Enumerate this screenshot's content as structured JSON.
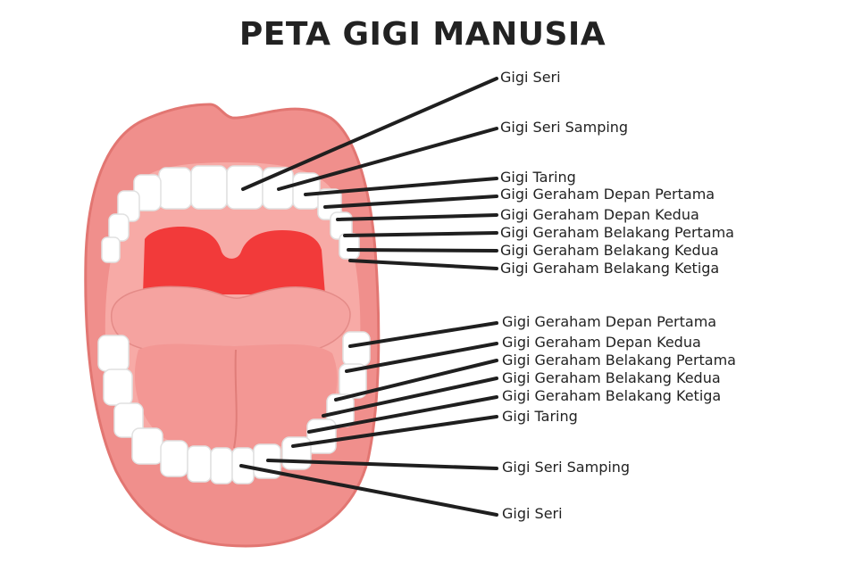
{
  "title": "PETA GIGI MANUSIA",
  "colors": {
    "lip": "#f08f8c",
    "lip_edge": "#e07672",
    "mouth_inner": "#f7a7a4",
    "throat": "#f23a3a",
    "tongue": "#f5a09c",
    "tooth": "#ffffff",
    "leader_line": "#1f1f1f"
  },
  "labels": {
    "upper": [
      "Gigi Seri",
      "Gigi Seri Samping",
      "Gigi Taring",
      "Gigi Geraham Depan Pertama",
      "Gigi Geraham Depan Kedua",
      "Gigi Geraham Belakang Pertama",
      "Gigi Geraham Belakang Kedua",
      "Gigi Geraham Belakang Ketiga"
    ],
    "lower": [
      "Gigi Geraham Depan Pertama",
      "Gigi Geraham Depan Kedua",
      "Gigi Geraham Belakang Pertama",
      "Gigi Geraham Belakang Kedua",
      "Gigi Geraham Belakang Ketiga",
      "Gigi Taring",
      "Gigi Seri Samping",
      "Gigi Seri"
    ]
  }
}
